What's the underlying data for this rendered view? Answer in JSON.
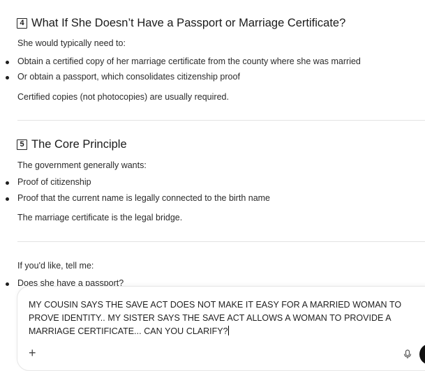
{
  "section4": {
    "number": "4",
    "title": "What If She Doesn’t Have a Passport or Marriage Certificate?",
    "intro": "She would typically need to:",
    "bullets": [
      "Obtain a certified copy of her marriage certificate from the county where she was married",
      "Or obtain a passport, which consolidates citizenship proof"
    ],
    "note": "Certified copies (not photocopies) are usually required."
  },
  "section5": {
    "number": "5",
    "title": "The Core Principle",
    "intro": "The government generally wants:",
    "bullets": [
      "Proof of citizenship",
      "Proof that the current name is legally connected to the birth name"
    ],
    "note": "The marriage certificate is the legal bridge."
  },
  "followup": {
    "intro": "If you'd like, tell me:",
    "bullets": [
      "Does she have a passport?"
    ]
  },
  "composer": {
    "text": "MY COUSIN SAYS THE SAVE ACT DOES NOT MAKE IT EASY FOR A MARRIED WOMAN TO PROVE IDENTITY.. MY SISTER SAYS THE SAVE ACT ALLOWS A WOMAN TO PROVIDE A MARRIAGE CERTIFICATE... CAN YOU CLARIFY?",
    "plus_label": "+",
    "icons": {
      "add": "plus-icon",
      "mic": "microphone-icon",
      "send": "send-icon"
    }
  }
}
